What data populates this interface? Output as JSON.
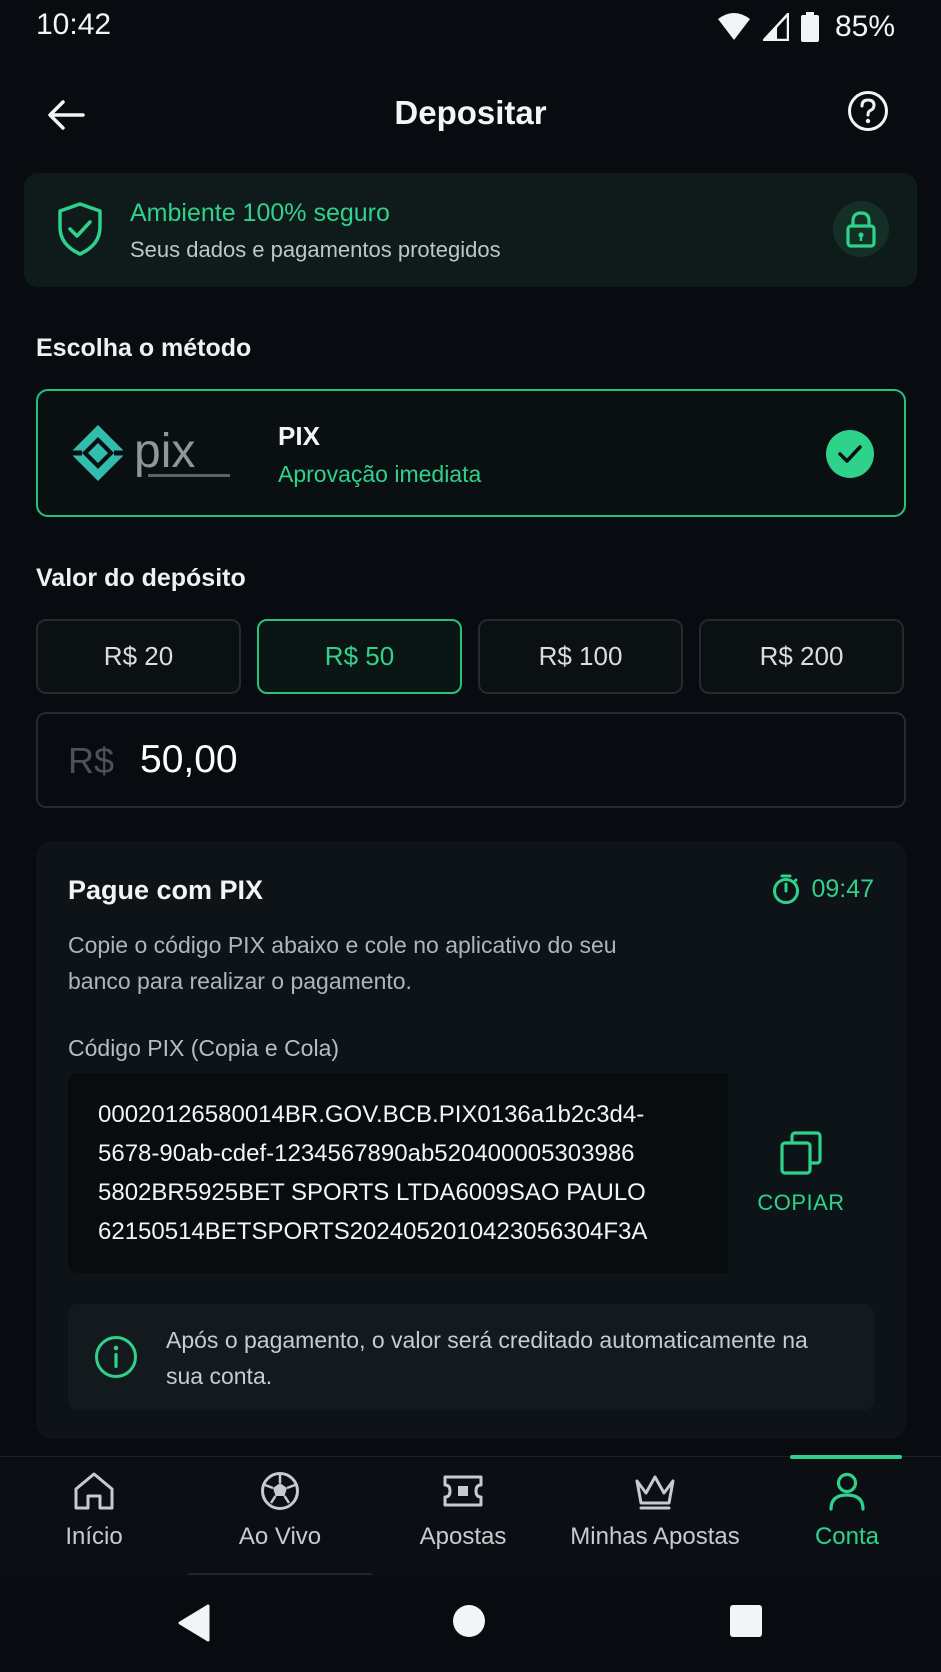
{
  "status_bar": {
    "time": "10:42",
    "battery": "85%"
  },
  "header": {
    "title": "Depositar"
  },
  "secure_banner": {
    "title": "Ambiente 100% seguro",
    "subtitle": "Seus dados e pagamentos protegidos"
  },
  "method_section": {
    "label": "Escolha o método",
    "selected": {
      "name": "PIX",
      "subtitle": "Aprovação imediata"
    }
  },
  "amount_section": {
    "label": "Valor do depósito",
    "chips": [
      "R$ 20",
      "R$ 50",
      "R$ 100",
      "R$ 200"
    ],
    "selected_chip": "R$ 50",
    "currency_prefix": "R$",
    "value": "50,00"
  },
  "pix_payment": {
    "title": "Pague com PIX",
    "timer": "09:47",
    "description": "Copie o código PIX abaixo e cole no aplicativo do seu banco para realizar o pagamento.",
    "code_label": "Código PIX (Copia e Cola)",
    "code_lines": [
      "00020126580014BR.GOV.BCB.PIX0136a1b2c3d4-",
      "5678-90ab-cdef-1234567890ab520400005303986",
      "5802BR5925BET SPORTS LTDA6009SAO PAULO",
      "62150514BETSPORTS2024052010423056304F3A"
    ],
    "copy_label": "COPIAR",
    "info_text": "Após o pagamento, o valor será creditado automaticamente na sua conta."
  },
  "bottom_nav": {
    "items": [
      {
        "label": "Início",
        "icon": "home-icon"
      },
      {
        "label": "Ao Vivo",
        "icon": "soccer-ball-icon"
      },
      {
        "label": "Apostas",
        "icon": "ticket-icon"
      },
      {
        "label": "Minhas Apostas",
        "icon": "crown-icon"
      },
      {
        "label": "Conta",
        "icon": "user-icon"
      }
    ],
    "active": "Conta"
  },
  "colors": {
    "accent": "#2fd28b",
    "background": "#080c10",
    "card": "#0d1317"
  }
}
